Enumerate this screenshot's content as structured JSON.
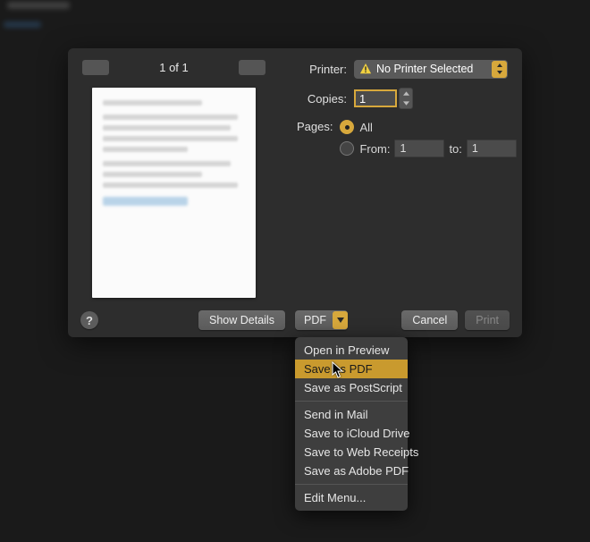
{
  "preview": {
    "page_counter": "1 of 1"
  },
  "printer": {
    "label": "Printer:",
    "selected": "No Printer Selected"
  },
  "copies": {
    "label": "Copies:",
    "value": "1"
  },
  "pages": {
    "label": "Pages:",
    "all_label": "All",
    "from_label": "From:",
    "to_label": "to:",
    "from_value": "1",
    "to_value": "1",
    "selected": "all"
  },
  "buttons": {
    "help": "?",
    "show_details": "Show Details",
    "pdf": "PDF",
    "cancel": "Cancel",
    "print": "Print"
  },
  "pdf_menu": {
    "items": [
      "Open in Preview",
      "Save as PDF",
      "Save as PostScript",
      "Send in Mail",
      "Save to iCloud Drive",
      "Save to Web Receipts",
      "Save as Adobe PDF",
      "Edit Menu..."
    ],
    "highlighted_index": 1,
    "separators_after": [
      2,
      6
    ]
  }
}
